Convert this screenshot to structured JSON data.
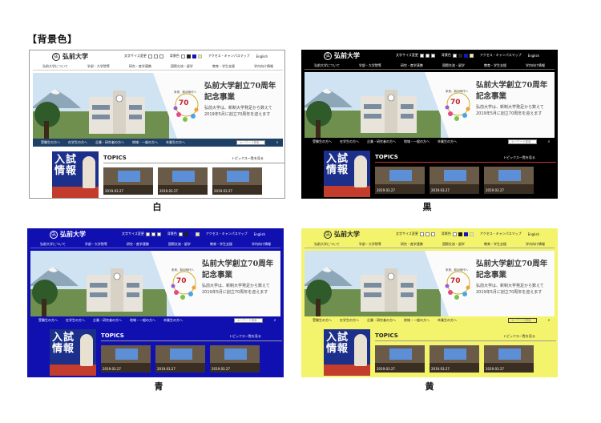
{
  "section_heading": "【背景色】",
  "site": {
    "logo_text": "弘前大学",
    "logo_mark": "弘",
    "util": {
      "font_size_label": "文字サイズ変更",
      "sizes": [
        "小",
        "中",
        "大"
      ],
      "bg_label": "背景色",
      "access": "アクセス・キャンパスマップ",
      "english": "English"
    },
    "global_nav": [
      "弘前大学について",
      "学部・大学院等",
      "研究・産学連携",
      "国際交流・留学",
      "教育・学生支援",
      "学内向け情報"
    ],
    "hero": {
      "title_line1": "弘前大学創立70周年",
      "title_line2": "記念事業",
      "body_line1": "弘前大学は、新制大学発足から数えて",
      "body_line2": "2019年5月に創立70周年を迎えます",
      "emblem_number": "70",
      "emblem_top": "未来、前の時代へ"
    },
    "sub_nav": [
      "受験生の方へ",
      "在学生の方へ",
      "企業・研究者の方へ",
      "地域・一般の方へ",
      "卒業生の方へ"
    ],
    "search_placeholder": "キーワード検索",
    "ad_text_line1": "入試",
    "ad_text_line2": "情報",
    "topics_title": "TOPICS",
    "topics_link": "トピックス一覧を見る",
    "topic_dates": [
      "2019.03.27",
      "2019.03.27",
      "2019.03.27"
    ]
  },
  "panels": [
    {
      "caption": "白",
      "bg_color": "#ffffff"
    },
    {
      "caption": "黒",
      "bg_color": "#000000"
    },
    {
      "caption": "青",
      "bg_color": "#1010b0"
    },
    {
      "caption": "黄",
      "bg_color": "#f4f46c"
    }
  ]
}
